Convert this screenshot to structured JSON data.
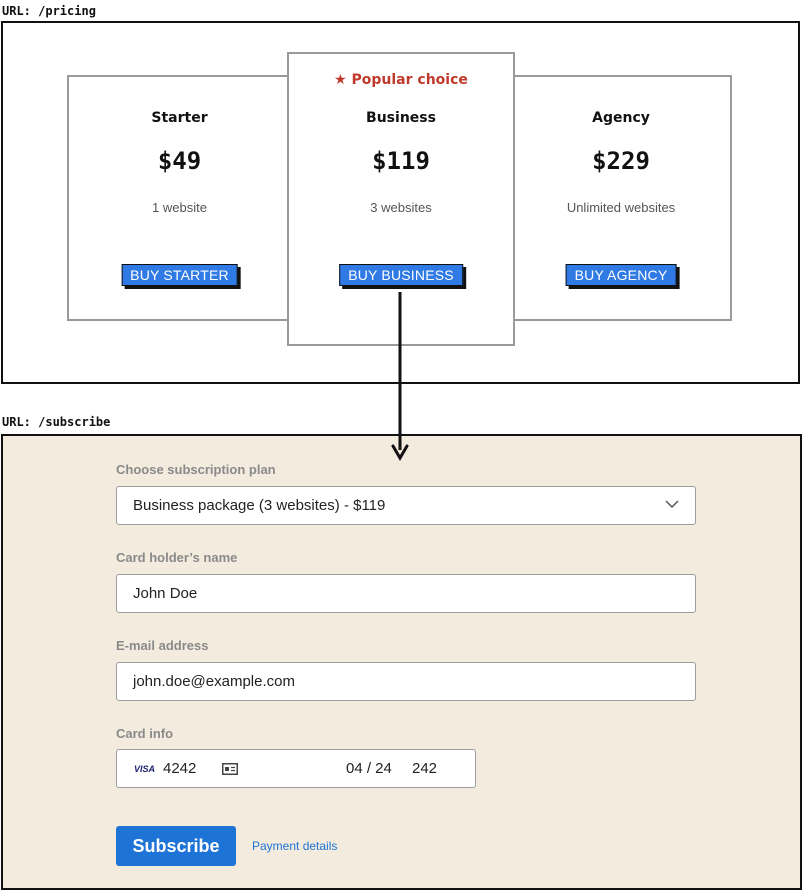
{
  "pricing_page": {
    "url": "URL: /pricing",
    "plans": [
      {
        "name": "Starter",
        "price": "$49",
        "sites": "1 website",
        "button": "BUY STARTER"
      },
      {
        "name": "Business",
        "price": "$119",
        "sites": "3 websites",
        "button": "BUY BUSINESS",
        "badge": "★ Popular choice"
      },
      {
        "name": "Agency",
        "price": "$229",
        "sites": "Unlimited websites",
        "button": "BUY AGENCY"
      }
    ]
  },
  "subscribe_page": {
    "url": "URL: /subscribe",
    "plan_label": "Choose subscription plan",
    "plan_value": "Business package (3 websites) - $119",
    "name_label": "Card holder’s name",
    "name_value": "John Doe",
    "email_label": "E-mail address",
    "email_value": "john.doe@example.com",
    "card_label": "Card info",
    "card": {
      "brand": "VISA",
      "number": "4242",
      "expiry": "04 / 24",
      "cvc": "242"
    },
    "subscribe_button": "Subscribe",
    "payment_link": "Payment details"
  },
  "colors": {
    "accent_blue": "#2f7ae5",
    "badge_red": "#c0392b",
    "form_bg": "#f3ebdd"
  },
  "icons": [
    "chevron-down-icon",
    "card-icon",
    "arrow-down-icon",
    "star-icon"
  ]
}
